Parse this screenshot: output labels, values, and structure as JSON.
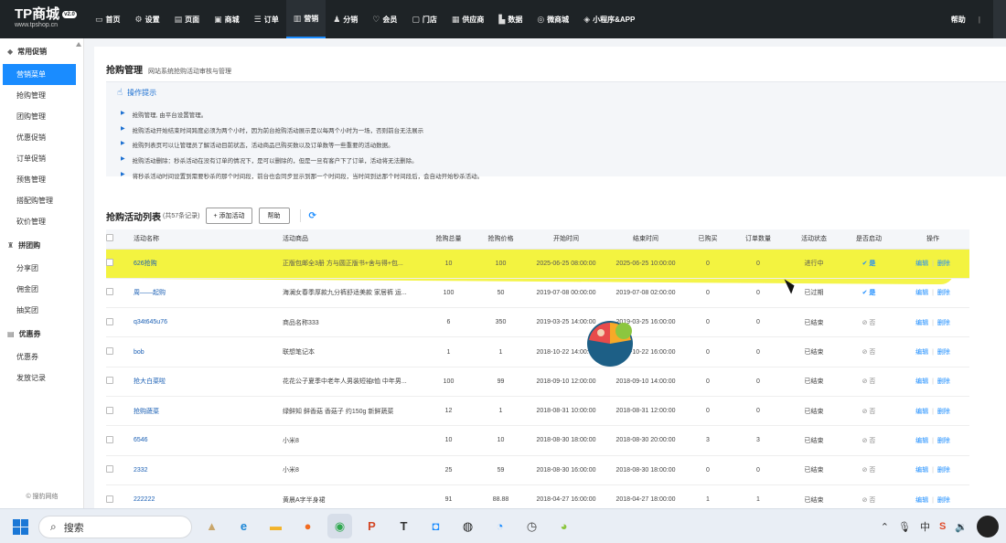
{
  "header": {
    "logo_text": "TP商城",
    "logo_badge": "v2.0",
    "logo_sub": "www.tpshop.cn",
    "nav": [
      {
        "label": "首页",
        "icon": "monitor-icon"
      },
      {
        "label": "设置",
        "icon": "gear-icon"
      },
      {
        "label": "页面",
        "icon": "page-icon"
      },
      {
        "label": "商城",
        "icon": "store-icon"
      },
      {
        "label": "订单",
        "icon": "order-icon"
      },
      {
        "label": "营销",
        "icon": "chart-icon"
      },
      {
        "label": "分销",
        "icon": "users-icon"
      },
      {
        "label": "会员",
        "icon": "heart-icon"
      },
      {
        "label": "门店",
        "icon": "shop-icon"
      },
      {
        "label": "供应商",
        "icon": "supplier-icon"
      },
      {
        "label": "数据",
        "icon": "data-icon"
      },
      {
        "label": "微商城",
        "icon": "wechat-icon"
      },
      {
        "label": "小程序&APP",
        "icon": "miniapp-icon"
      }
    ],
    "active_nav": "营销",
    "help": "帮助",
    "sep": "|"
  },
  "sidebar": {
    "groups": [
      {
        "title": "常用促销",
        "icon": "tag-icon",
        "items": [
          "营销菜单",
          "抢购管理",
          "团购管理",
          "优惠促销",
          "订单促销",
          "预售管理",
          "搭配购管理",
          "砍价管理"
        ]
      },
      {
        "title": "拼团购",
        "icon": "group-icon",
        "items": [
          "分享团",
          "佣金团",
          "抽奖团"
        ]
      },
      {
        "title": "优惠券",
        "icon": "coupon-icon",
        "items": [
          "优惠券",
          "发放记录"
        ]
      }
    ],
    "active_item": "营销菜单",
    "footer": "© 搜豹网络"
  },
  "main": {
    "title": "抢购管理",
    "subtitle": "网站系统抢购活动审核与管理",
    "tips_title": "操作提示",
    "tips": [
      "抢购管理, 由平台设置管理。",
      "抢购活动开始结束时间跨度必须为两个小时，因为前台抢购活动展示是以每两个小时为一场，否则前台无法展示",
      "抢购列表页可以让管理员了解活动目前状态，活动商品已购买数以及订单数等一些重要的活动数据。",
      "抢购活动删除：秒杀活动在没有订单的情况下，是可以删除的，但是一旦有客户下了订单，活动将无法删除。",
      "将秒杀活动时间设置到需要秒杀的那个时间段，前台也会同步显示到那一个时间段，当时间到达那个时间段后，会自动开始秒杀活动。"
    ],
    "list_title": "抢购活动列表",
    "list_count": "(共57条记录)",
    "add_button": "+ 添加活动",
    "help_button": "帮助",
    "columns": [
      "活动名称",
      "活动商品",
      "抢购总量",
      "抢购价格",
      "开始时间",
      "结束时间",
      "已购买",
      "订单数量",
      "活动状态",
      "是否启动",
      "操作"
    ],
    "rows": [
      {
        "name": "626抢购",
        "goods": "正版包邮全3册 方与圆正版书+舍与得+包...",
        "total": "10",
        "price": "100",
        "start": "2025-06-25 08:00:00",
        "end": "2025-06-25 10:00:00",
        "bought": "0",
        "orders": "0",
        "status": "进行中",
        "enabled": "是",
        "on": true
      },
      {
        "name": "周——起购",
        "goods": "海澜女春季厚款九分裤舒适美款 家居裤 运...",
        "total": "100",
        "price": "50",
        "start": "2019-07-08 00:00:00",
        "end": "2019-07-08 02:00:00",
        "bought": "0",
        "orders": "0",
        "status": "已过期",
        "enabled": "是",
        "on": true
      },
      {
        "name": "q34t645u76",
        "goods": "商品名称333",
        "total": "6",
        "price": "350",
        "start": "2019-03-25 14:00:00",
        "end": "2019-03-25 16:00:00",
        "bought": "0",
        "orders": "0",
        "status": "已结束",
        "enabled": "否",
        "on": false
      },
      {
        "name": "bob",
        "goods": "联想笔记本",
        "total": "1",
        "price": "1",
        "start": "2018-10-22 14:00:00",
        "end": "2018-10-22 16:00:00",
        "bought": "0",
        "orders": "0",
        "status": "已结束",
        "enabled": "否",
        "on": false
      },
      {
        "name": "抢大白菜啦",
        "goods": "花花公子夏季中老年人男装短袖t恤 中年男...",
        "total": "100",
        "price": "99",
        "start": "2018-09-10 12:00:00",
        "end": "2018-09-10 14:00:00",
        "bought": "0",
        "orders": "0",
        "status": "已结束",
        "enabled": "否",
        "on": false
      },
      {
        "name": "抢购蔬菜",
        "goods": "绿鲜知 鲜香菇 香菇子 约150g 新鲜蔬菜",
        "total": "12",
        "price": "1",
        "start": "2018-08-31 10:00:00",
        "end": "2018-08-31 12:00:00",
        "bought": "0",
        "orders": "0",
        "status": "已结束",
        "enabled": "否",
        "on": false
      },
      {
        "name": "6546",
        "goods": "小米8",
        "total": "10",
        "price": "10",
        "start": "2018-08-30 18:00:00",
        "end": "2018-08-30 20:00:00",
        "bought": "3",
        "orders": "3",
        "status": "已结束",
        "enabled": "否",
        "on": false
      },
      {
        "name": "2332",
        "goods": "小米8",
        "total": "25",
        "price": "59",
        "start": "2018-08-30 16:00:00",
        "end": "2018-08-30 18:00:00",
        "bought": "0",
        "orders": "0",
        "status": "已结束",
        "enabled": "否",
        "on": false
      },
      {
        "name": "222222",
        "goods": "黄晨A字半身裙",
        "total": "91",
        "price": "88.88",
        "start": "2018-04-27 16:00:00",
        "end": "2018-04-27 18:00:00",
        "bought": "1",
        "orders": "1",
        "status": "已结束",
        "enabled": "否",
        "on": false
      }
    ],
    "edit_label": "编辑",
    "delete_label": "删除"
  },
  "taskbar": {
    "search_placeholder": "搜索",
    "apps": [
      {
        "name": "desert-icon",
        "color": "#c9a66b",
        "glyph": "▲"
      },
      {
        "name": "edge-icon",
        "color": "#1b86d6",
        "glyph": "e"
      },
      {
        "name": "folder-icon",
        "color": "#f2b32a",
        "glyph": "▬"
      },
      {
        "name": "firefox-icon",
        "color": "#f26b21",
        "glyph": "●"
      },
      {
        "name": "chrome-icon",
        "color": "#2fa84f",
        "glyph": "◉"
      },
      {
        "name": "powerpoint-icon",
        "color": "#d24726",
        "glyph": "P"
      },
      {
        "name": "typora-icon",
        "color": "#333333",
        "glyph": "T"
      },
      {
        "name": "qq-icon",
        "color": "#1a8cff",
        "glyph": "◘"
      },
      {
        "name": "obs-icon",
        "color": "#222222",
        "glyph": "◍"
      },
      {
        "name": "chat-icon",
        "color": "#1a8cff",
        "glyph": "◔"
      },
      {
        "name": "clock-icon",
        "color": "#444444",
        "glyph": "◷"
      },
      {
        "name": "lime-icon",
        "color": "#8cc63f",
        "glyph": "◕"
      }
    ],
    "active_app": "chrome-icon"
  },
  "colors": {
    "accent": "#1a8cff",
    "topbar": "#1e2326",
    "highlight": "#f3f340"
  }
}
